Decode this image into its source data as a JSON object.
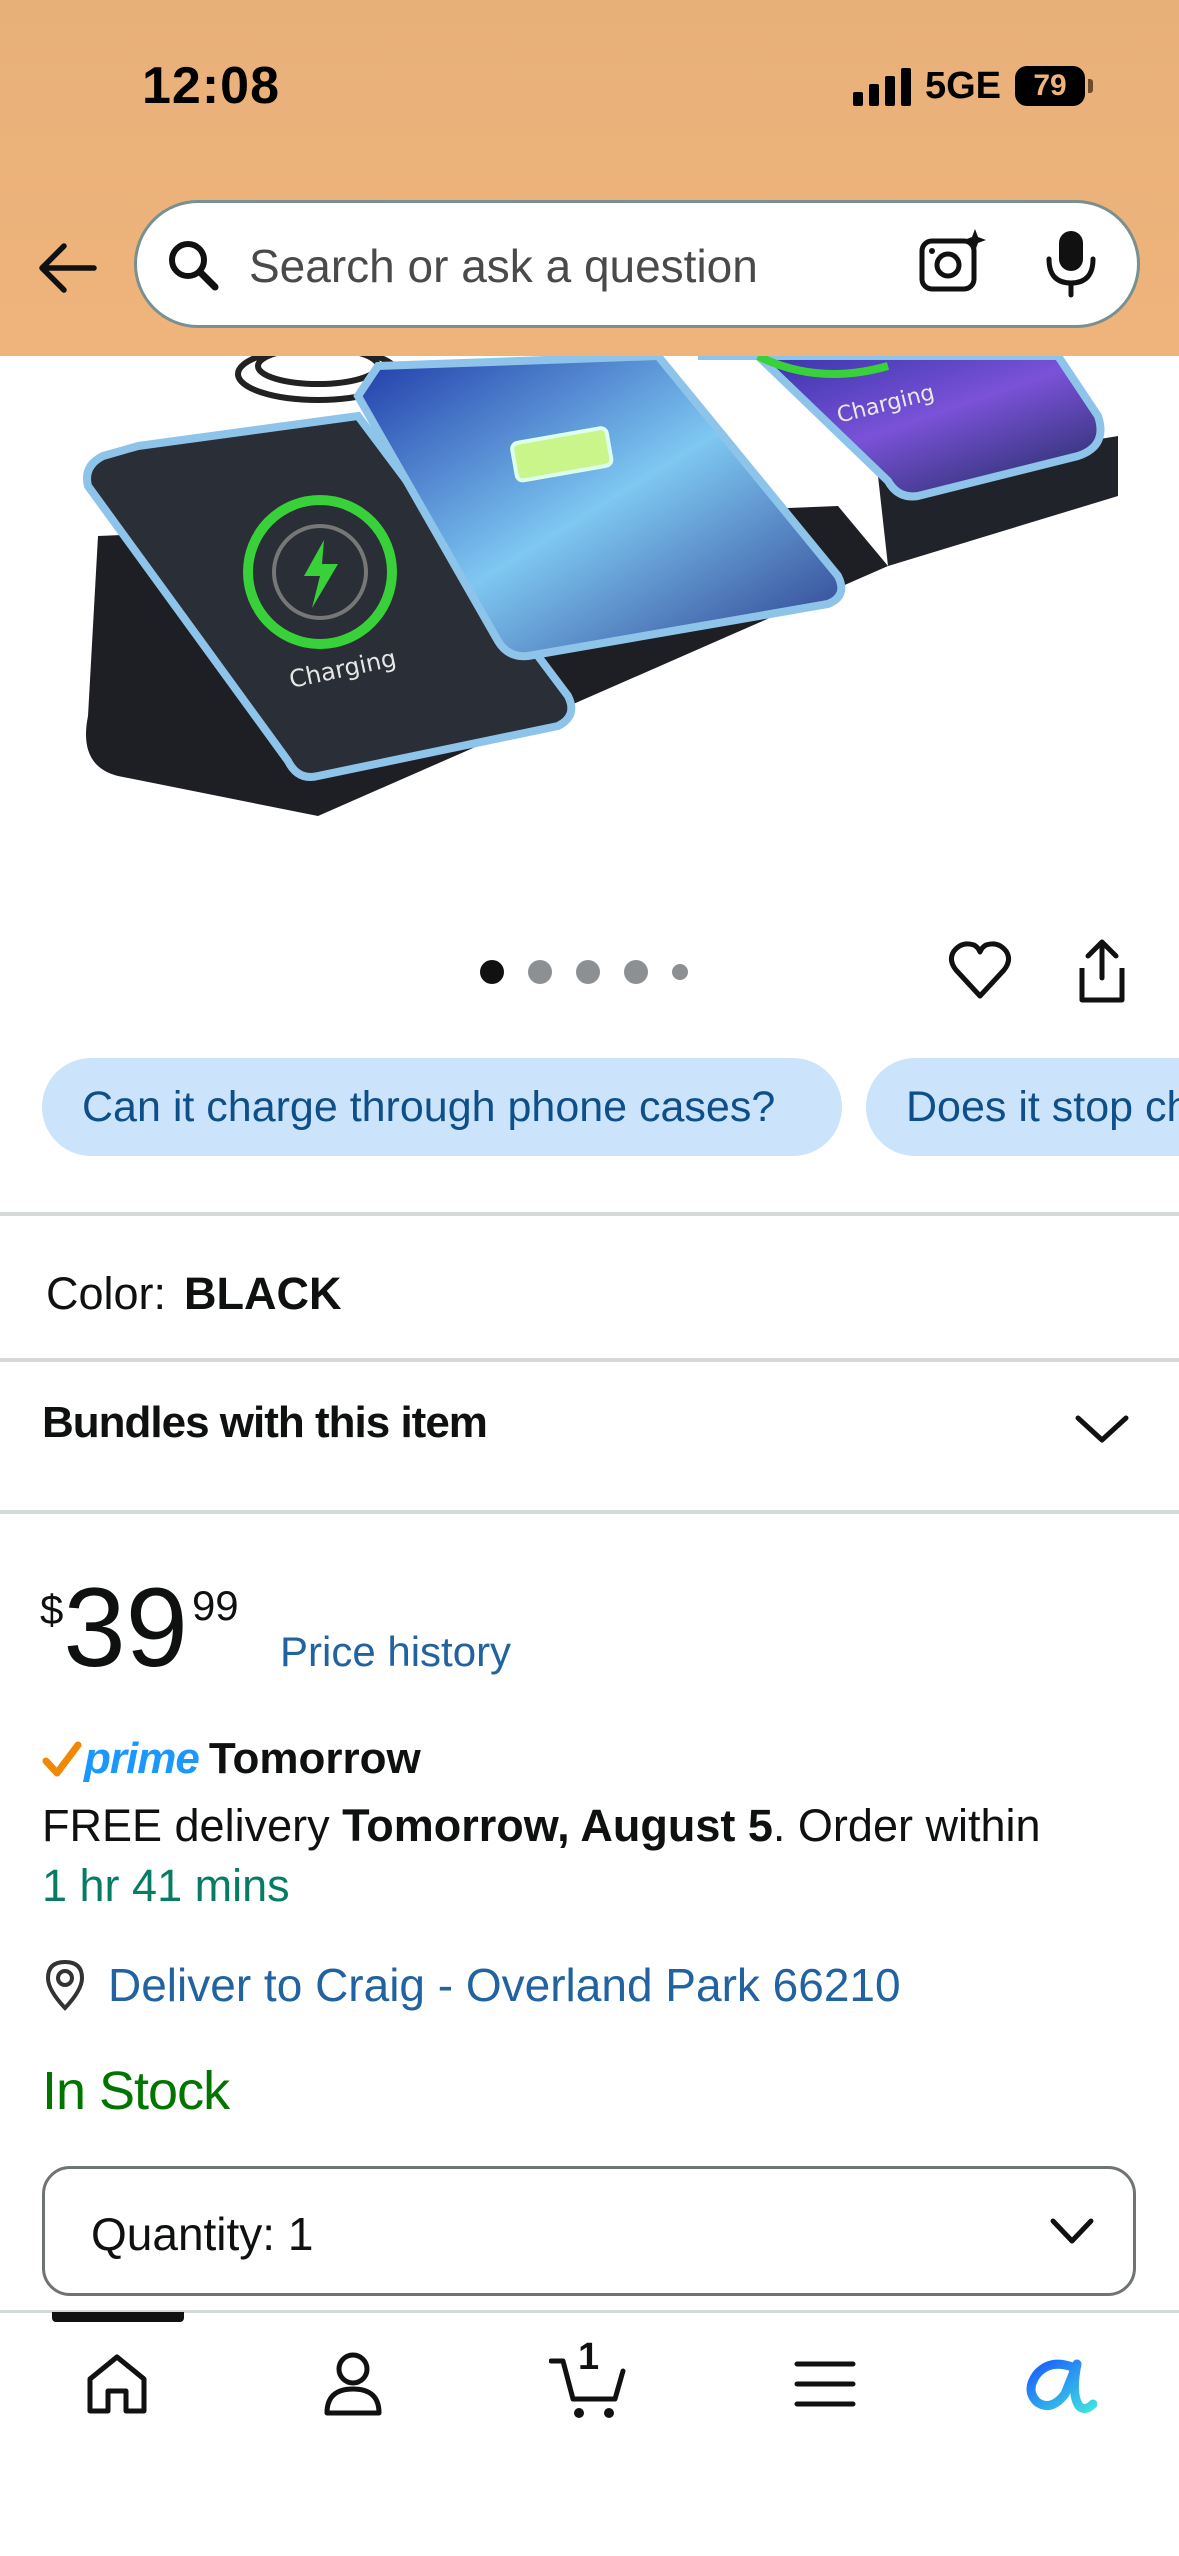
{
  "status_bar": {
    "time": "12:08",
    "network": "5GE",
    "battery": "79"
  },
  "search": {
    "placeholder": "Search or ask a question"
  },
  "product_image": {
    "charging_label": "Charging"
  },
  "carousel": {
    "count": 5,
    "active": 1
  },
  "questions": [
    "Can it charge through phone cases?",
    "Does it stop charging when full?"
  ],
  "color": {
    "label": "Color:",
    "value": "BLACK"
  },
  "bundles": {
    "label": "Bundles with this item"
  },
  "price": {
    "symbol": "$",
    "whole": "39",
    "cents": "99",
    "history_link": "Price history"
  },
  "prime": {
    "word": "prime",
    "when": "Tomorrow"
  },
  "delivery": {
    "prefix": "FREE delivery ",
    "date": "Tomorrow, August 5",
    "suffix": ". Order within",
    "countdown": "1 hr 41 mins"
  },
  "deliver_to": {
    "text": "Deliver to Craig - Overland Park 66210"
  },
  "stock": {
    "text": "In Stock"
  },
  "quantity": {
    "text": "Quantity:  1"
  },
  "tabbar": {
    "cart_count": "1"
  },
  "colors": {
    "header": "#efb47c",
    "link": "#2162a1",
    "in_stock": "#007600",
    "chip_bg": "#cbe3fb"
  }
}
